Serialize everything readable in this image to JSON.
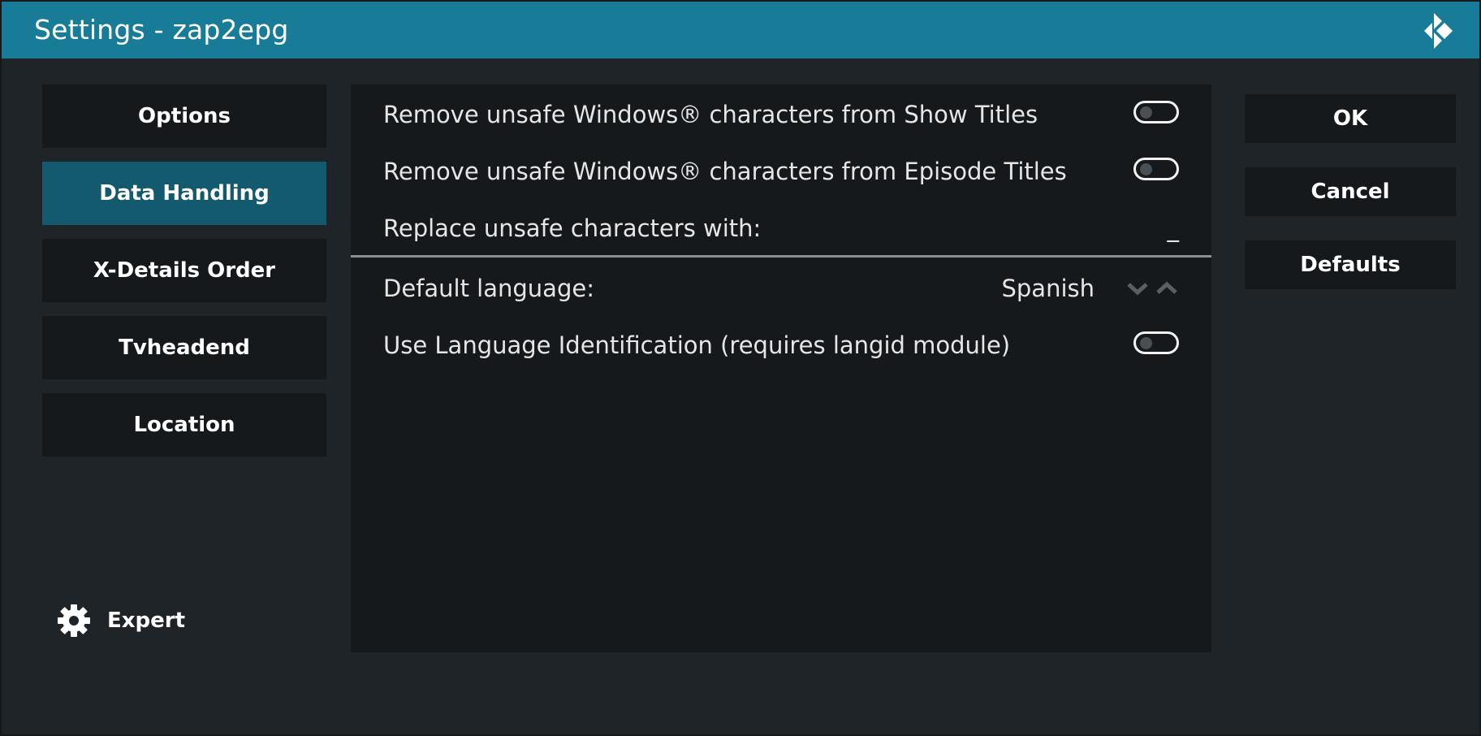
{
  "window": {
    "title": "Settings - zap2epg",
    "logo_icon": "kodi-logo-icon"
  },
  "categories": [
    {
      "label": "Options",
      "active": false
    },
    {
      "label": "Data Handling",
      "active": true
    },
    {
      "label": "X-Details Order",
      "active": false
    },
    {
      "label": "Tvheadend",
      "active": false
    },
    {
      "label": "Location",
      "active": false
    }
  ],
  "expert": {
    "label": "Expert",
    "icon": "gear-icon"
  },
  "settings": [
    {
      "label": "Remove unsafe Windows® characters from Show Titles",
      "type": "toggle",
      "enabled": false
    },
    {
      "label": "Remove unsafe Windows® characters from Episode Titles",
      "type": "toggle",
      "enabled": false
    },
    {
      "label": "Replace unsafe characters with:",
      "type": "text",
      "value": "_"
    },
    {
      "label": "Default language:",
      "type": "spinner",
      "value": "Spanish"
    },
    {
      "label": "Use Language Identification (requires langid module)",
      "type": "toggle",
      "enabled": false
    }
  ],
  "actions": {
    "ok": "OK",
    "cancel": "Cancel",
    "defaults": "Defaults"
  },
  "colors": {
    "titlebar": "#187b98",
    "active_category": "#145a6e",
    "panel": "#15191b",
    "background": "#1f2428"
  }
}
